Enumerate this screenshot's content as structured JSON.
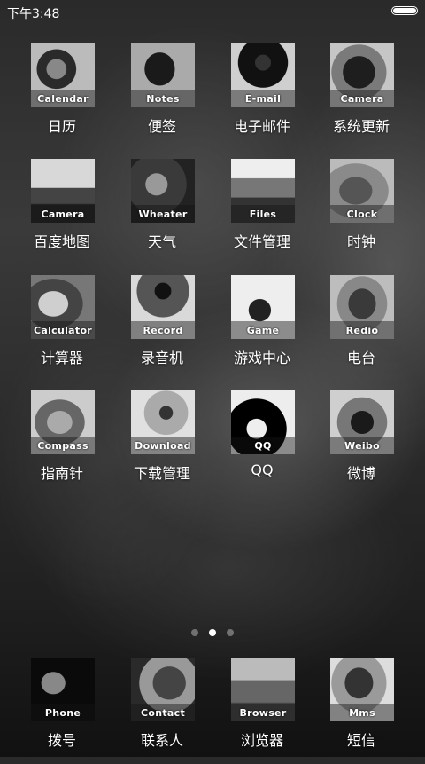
{
  "status_bar": {
    "time": "下午3:48"
  },
  "page_indicator": {
    "count": 3,
    "active": 2
  },
  "apps": [
    {
      "icon_text": "Calendar",
      "label": "日历"
    },
    {
      "icon_text": "Notes",
      "label": "便签"
    },
    {
      "icon_text": "E-mail",
      "label": "电子邮件"
    },
    {
      "icon_text": "Camera",
      "label": "系统更新"
    },
    {
      "icon_text": "Camera",
      "label": "百度地图"
    },
    {
      "icon_text": "Wheater",
      "label": "天气"
    },
    {
      "icon_text": "Files",
      "label": "文件管理"
    },
    {
      "icon_text": "Clock",
      "label": "时钟"
    },
    {
      "icon_text": "Calculator",
      "label": "计算器"
    },
    {
      "icon_text": "Record",
      "label": "录音机"
    },
    {
      "icon_text": "Game",
      "label": "游戏中心"
    },
    {
      "icon_text": "Redio",
      "label": "电台"
    },
    {
      "icon_text": "Compass",
      "label": "指南针"
    },
    {
      "icon_text": "Download",
      "label": "下载管理"
    },
    {
      "icon_text": "QQ",
      "label": "QQ"
    },
    {
      "icon_text": "Weibo",
      "label": "微博"
    }
  ],
  "dock": [
    {
      "icon_text": "Phone",
      "label": "拨号"
    },
    {
      "icon_text": "Contact",
      "label": "联系人"
    },
    {
      "icon_text": "Browser",
      "label": "浏览器"
    },
    {
      "icon_text": "Mms",
      "label": "短信"
    }
  ]
}
